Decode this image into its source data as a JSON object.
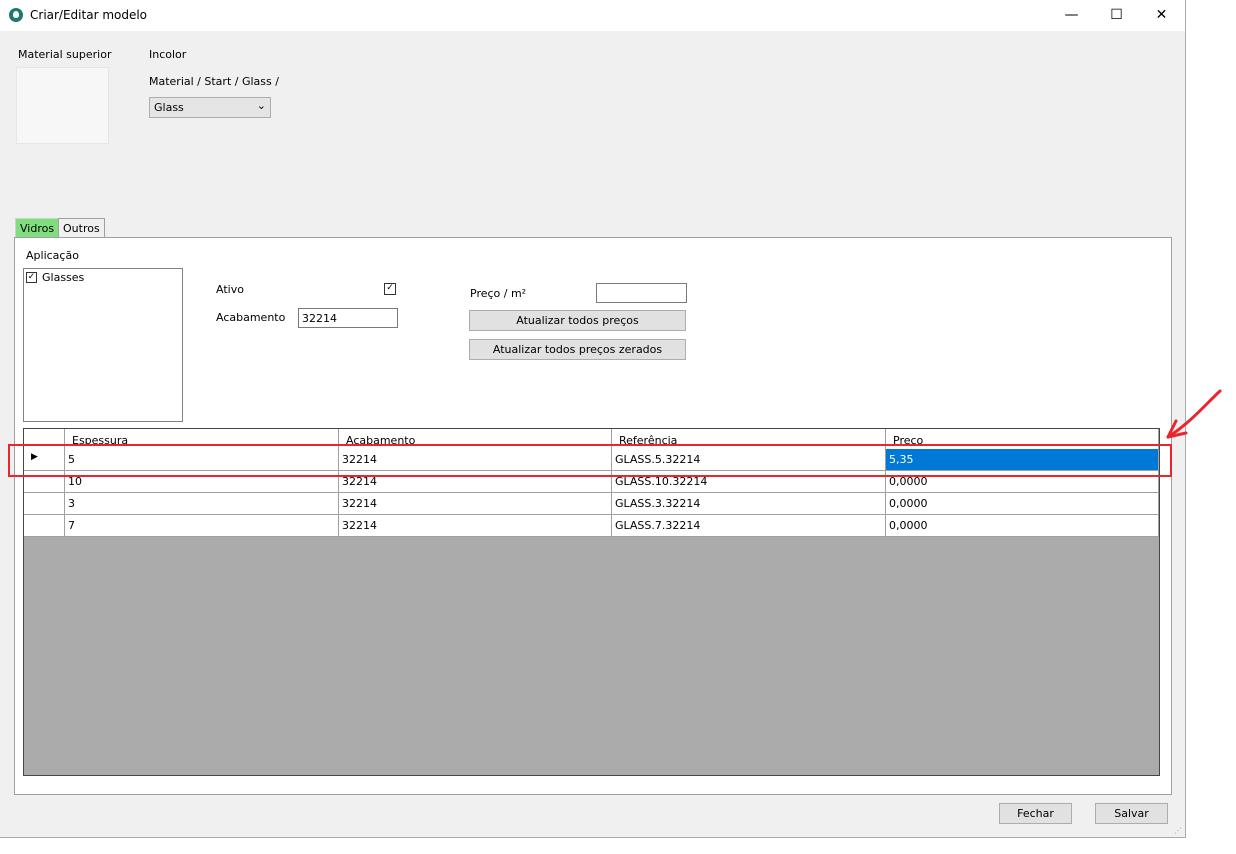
{
  "window": {
    "title": "Criar/Editar modelo",
    "minimize": "—",
    "maximize": "☐",
    "close": "✕"
  },
  "header": {
    "material_superior_label": "Material superior",
    "material_name": "Incolor",
    "material_path": "Material / Start / Glass /",
    "material_select_value": "Glass"
  },
  "tabs": [
    {
      "label": "Vidros",
      "active": true
    },
    {
      "label": "Outros",
      "active": false
    }
  ],
  "form": {
    "aplicacao_label": "Aplicação",
    "aplicacao_items": [
      {
        "label": "Glasses",
        "checked": true
      }
    ],
    "ativo_label": "Ativo",
    "ativo_checked": true,
    "acabamento_label": "Acabamento",
    "acabamento_value": "32214",
    "preco_m2_label": "Preço / m²",
    "preco_m2_value": "",
    "btn_atualizar": "Atualizar todos preços",
    "btn_atualizar_zerados": "Atualizar todos preços zerados"
  },
  "grid": {
    "columns": [
      "Espessura",
      "Acabamento",
      "Referência",
      "Preço"
    ],
    "rows": [
      {
        "espessura": "5",
        "acabamento": "32214",
        "referencia": "GLASS.5.32214",
        "preco": "5,35",
        "current": true
      },
      {
        "espessura": "10",
        "acabamento": "32214",
        "referencia": "GLASS.10.32214",
        "preco": "0,0000"
      },
      {
        "espessura": "3",
        "acabamento": "32214",
        "referencia": "GLASS.3.32214",
        "preco": "0,0000"
      },
      {
        "espessura": "7",
        "acabamento": "32214",
        "referencia": "GLASS.7.32214",
        "preco": "0,0000"
      }
    ]
  },
  "footer": {
    "fechar": "Fechar",
    "salvar": "Salvar"
  },
  "colors": {
    "selection": "#0078d7",
    "active_tab": "#7fdf7f",
    "annotation": "#e8262d"
  }
}
